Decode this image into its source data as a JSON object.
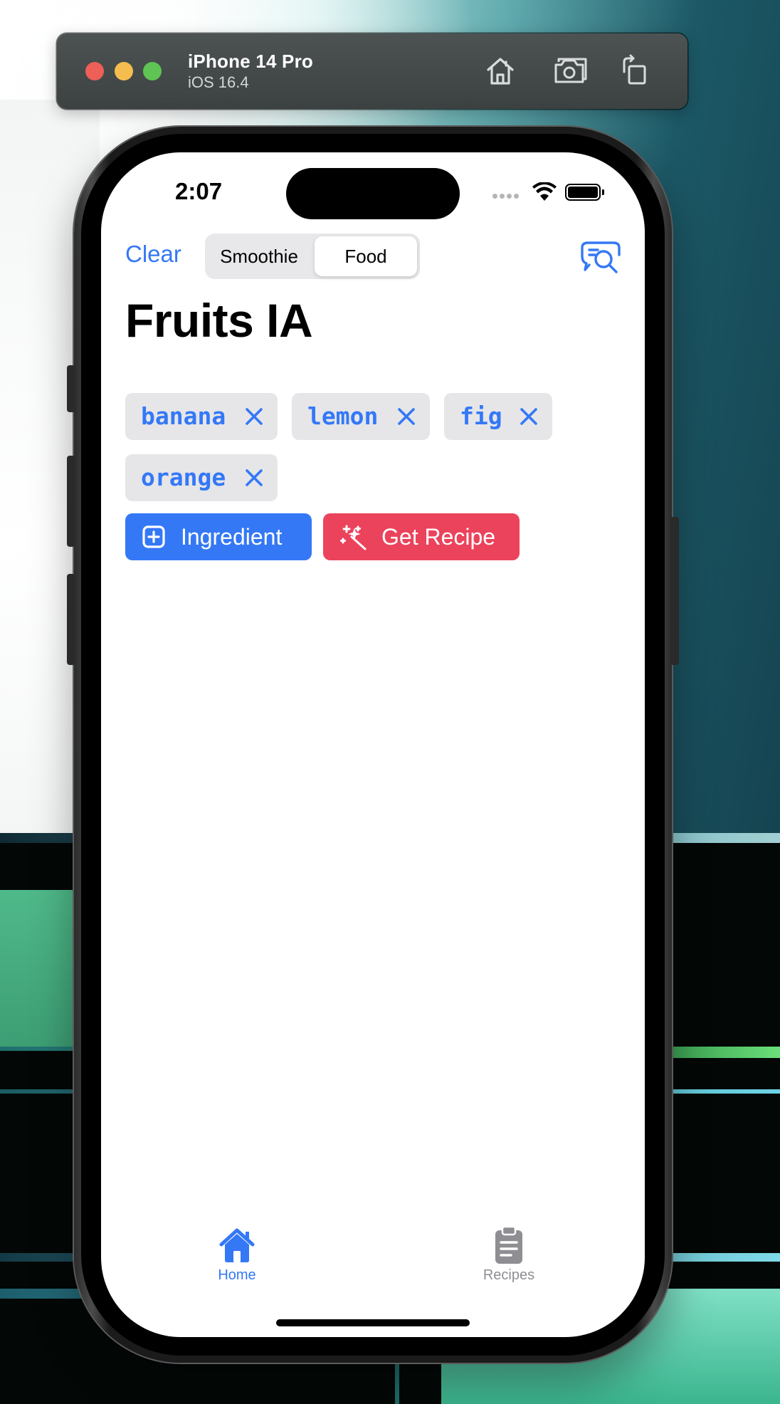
{
  "simulator": {
    "device_name": "iPhone 14 Pro",
    "os_version": "iOS 16.4",
    "tools": [
      "home-icon",
      "screenshot-icon",
      "rotate-icon"
    ]
  },
  "status_bar": {
    "time": "2:07"
  },
  "nav": {
    "clear_label": "Clear",
    "segments": [
      "Smoothie",
      "Food"
    ],
    "selected_segment": "Food"
  },
  "page": {
    "title": "Fruits IA"
  },
  "ingredients": [
    "banana",
    "lemon",
    "fig",
    "orange"
  ],
  "actions": {
    "add_ingredient_label": "Ingredient",
    "get_recipe_label": "Get Recipe"
  },
  "tab_bar": {
    "items": [
      {
        "label": "Home",
        "icon": "house-icon",
        "selected": true
      },
      {
        "label": "Recipes",
        "icon": "clipboard-icon",
        "selected": false
      }
    ]
  },
  "colors": {
    "accent_blue": "#3478f6",
    "recipe_red": "#eb435c",
    "chip_bg": "#e6e6e8"
  }
}
